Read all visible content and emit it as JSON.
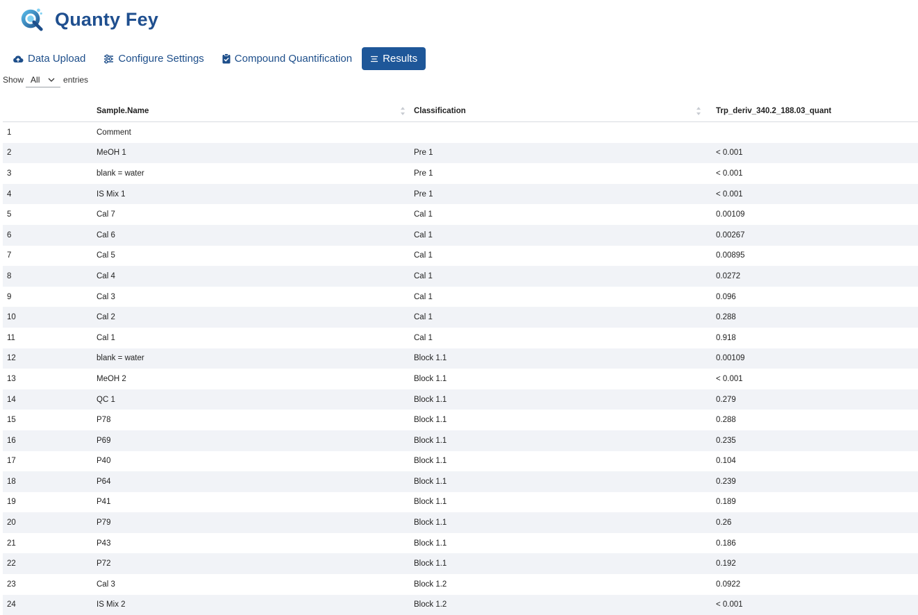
{
  "app": {
    "title": "Quanty Fey",
    "logo_icon": "flask-logo-icon"
  },
  "tabs": [
    {
      "label": "Data Upload",
      "icon": "cloud-upload-icon",
      "active": false
    },
    {
      "label": "Configure Settings",
      "icon": "sliders-icon",
      "active": false
    },
    {
      "label": "Compound Quantification",
      "icon": "clipboard-check-icon",
      "active": false
    },
    {
      "label": "Results",
      "icon": "list-icon",
      "active": true
    }
  ],
  "length": {
    "show_label": "Show",
    "value": "All",
    "entries_label": "entries"
  },
  "table": {
    "columns": [
      "",
      "Sample.Name",
      "Classification",
      "Trp_deriv_340.2_188.03_quant"
    ],
    "rows": [
      [
        "1",
        "Comment",
        "",
        ""
      ],
      [
        "2",
        "MeOH 1",
        "Pre 1",
        "< 0.001"
      ],
      [
        "3",
        "blank = water",
        "Pre 1",
        "< 0.001"
      ],
      [
        "4",
        "IS Mix 1",
        "Pre 1",
        "< 0.001"
      ],
      [
        "5",
        "Cal 7",
        "Cal 1",
        "0.00109"
      ],
      [
        "6",
        "Cal 6",
        "Cal 1",
        "0.00267"
      ],
      [
        "7",
        "Cal 5",
        "Cal 1",
        "0.00895"
      ],
      [
        "8",
        "Cal 4",
        "Cal 1",
        "0.0272"
      ],
      [
        "9",
        "Cal 3",
        "Cal 1",
        "0.096"
      ],
      [
        "10",
        "Cal 2",
        "Cal 1",
        "0.288"
      ],
      [
        "11",
        "Cal 1",
        "Cal 1",
        "0.918"
      ],
      [
        "12",
        "blank = water",
        "Block 1.1",
        "0.00109"
      ],
      [
        "13",
        "MeOH 2",
        "Block 1.1",
        "< 0.001"
      ],
      [
        "14",
        "QC 1",
        "Block 1.1",
        "0.279"
      ],
      [
        "15",
        "P78",
        "Block 1.1",
        "0.288"
      ],
      [
        "16",
        "P69",
        "Block 1.1",
        "0.235"
      ],
      [
        "17",
        "P40",
        "Block 1.1",
        "0.104"
      ],
      [
        "18",
        "P64",
        "Block 1.1",
        "0.239"
      ],
      [
        "19",
        "P41",
        "Block 1.1",
        "0.189"
      ],
      [
        "20",
        "P79",
        "Block 1.1",
        "0.26"
      ],
      [
        "21",
        "P43",
        "Block 1.1",
        "0.186"
      ],
      [
        "22",
        "P72",
        "Block 1.1",
        "0.192"
      ],
      [
        "23",
        "Cal 3",
        "Block 1.2",
        "0.0922"
      ],
      [
        "24",
        "IS Mix 2",
        "Block 1.2",
        "< 0.001"
      ]
    ]
  },
  "colors": {
    "brand": "#1f4f8f",
    "active_tab": "#1e5799",
    "stripe": "#f1f3f7"
  }
}
